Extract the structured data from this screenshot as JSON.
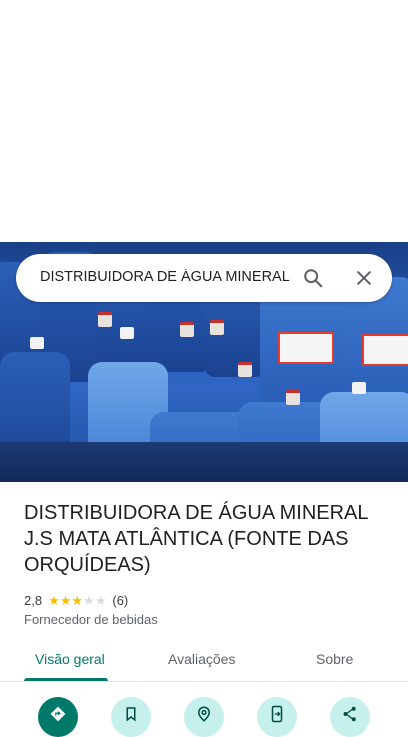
{
  "search": {
    "query": "DISTRIBUIDORA DE ÁGUA MINERAL"
  },
  "place": {
    "name": "DISTRIBUIDORA DE ÁGUA MINERAL J.S MATA ATLÂNTICA (FONTE DAS ORQUÍDEAS)",
    "rating": "2,8",
    "rating_value": 2.8,
    "stars_max": 5,
    "review_count": "(6)",
    "category": "Fornecedor de bebidas"
  },
  "tabs": [
    {
      "label": "Visão geral",
      "active": true
    },
    {
      "label": "Avaliações",
      "active": false
    },
    {
      "label": "Sobre",
      "active": false
    }
  ],
  "actions": [
    {
      "icon": "directions-icon"
    },
    {
      "icon": "bookmark-icon"
    },
    {
      "icon": "nearby-icon"
    },
    {
      "icon": "send-to-phone-icon"
    },
    {
      "icon": "share-icon"
    }
  ],
  "colors": {
    "accent": "#00796b",
    "accent_light": "#c6f0ec",
    "star": "#fbbc04"
  }
}
